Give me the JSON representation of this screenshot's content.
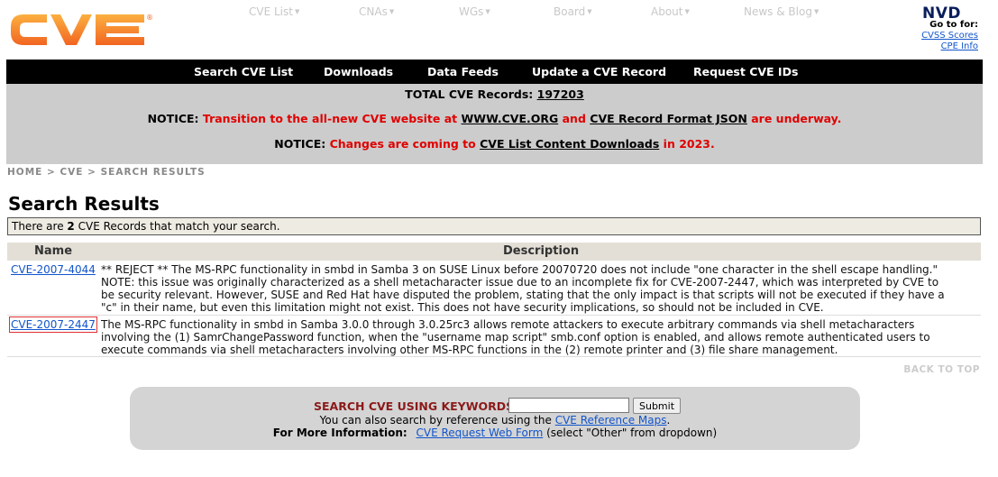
{
  "colors": {
    "logo_orange": "#f7941d",
    "menu_bg": "#000000",
    "notice_bg": "#cccccc",
    "notice_red": "#e00000",
    "link_blue": "#1155cc",
    "search_label": "#8b1a1a",
    "highlight_outline": "#e03030"
  },
  "header": {
    "logo_text": "CVE",
    "logo_reg": "®",
    "top_nav": [
      {
        "label": "CVE List"
      },
      {
        "label": "CNAs"
      },
      {
        "label": "WGs"
      },
      {
        "label": "Board"
      },
      {
        "label": "About"
      },
      {
        "label": "News & Blog"
      }
    ],
    "nvd": {
      "logo_text": "NVD",
      "goto_label": "Go to for:",
      "links": [
        "CVSS Scores",
        "CPE Info"
      ]
    }
  },
  "menu_bar": {
    "items": [
      "Search CVE List",
      "Downloads",
      "Data Feeds",
      "Update a CVE Record",
      "Request CVE IDs"
    ]
  },
  "notice": {
    "total_label": "TOTAL CVE Records:",
    "total_value": "197203",
    "line1": {
      "prefix": "NOTICE:",
      "red1": "Transition to the all-new CVE website at",
      "link1": "WWW.CVE.ORG",
      "red2": "and",
      "link2": "CVE Record Format JSON",
      "red3": "are underway."
    },
    "line2": {
      "prefix": "NOTICE:",
      "red1": "Changes are coming to",
      "link1": "CVE List Content Downloads",
      "red2": "in 2023."
    }
  },
  "breadcrumb": {
    "items": [
      "HOME",
      "CVE",
      "SEARCH RESULTS"
    ],
    "separator": ">"
  },
  "results": {
    "title": "Search Results",
    "match_prefix": "There are",
    "match_count": "2",
    "match_suffix": "CVE Records that match your search.",
    "columns": [
      "Name",
      "Description"
    ],
    "rows": [
      {
        "id": "CVE-2007-4044",
        "description": "** REJECT ** The MS-RPC functionality in smbd in Samba 3 on SUSE Linux before 20070720 does not include \"one character in the shell escape handling.\" NOTE: this issue was originally characterized as a shell metacharacter issue due to an incomplete fix for CVE-2007-2447, which was interpreted by CVE to be security relevant. However, SUSE and Red Hat have disputed the problem, stating that the only impact is that scripts will not be executed if they have a \"c\" in their name, but even this limitation might not exist. This does not have security implications, so should not be included in CVE."
      },
      {
        "id": "CVE-2007-2447",
        "description": "The MS-RPC functionality in smbd in Samba 3.0.0 through 3.0.25rc3 allows remote attackers to execute arbitrary commands via shell metacharacters involving the (1) SamrChangePassword function, when the \"username map script\" smb.conf option is enabled, and allows remote authenticated users to execute commands via shell metacharacters involving other MS-RPC functions in the (2) remote printer and (3) file share management."
      }
    ],
    "back_to_top": "BACK TO TOP"
  },
  "search_panel": {
    "label": "SEARCH CVE USING KEYWORDS:",
    "input_value": "",
    "submit_label": "Submit",
    "ref_prefix": "You can also search by reference using the",
    "ref_link": "CVE Reference Maps",
    "ref_suffix": ".",
    "info_label": "For More Information:",
    "info_link": "CVE Request Web Form",
    "info_suffix": "(select \"Other\" from dropdown)"
  }
}
